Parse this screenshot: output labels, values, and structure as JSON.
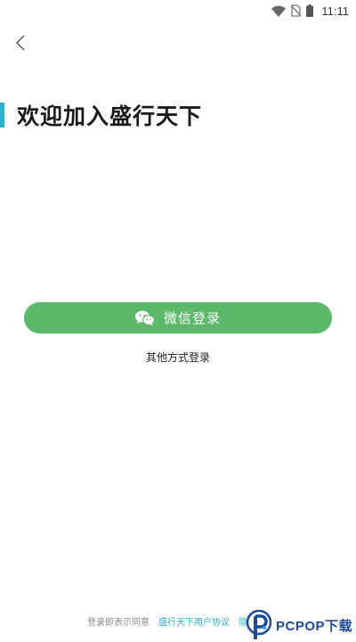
{
  "status_bar": {
    "time": "11:11"
  },
  "header": {
    "title": "欢迎加入盛行天下"
  },
  "login": {
    "wechat_label": "微信登录",
    "other_label": "其他方式登录"
  },
  "agreement": {
    "prefix": "登录即表示同意",
    "user_agreement": "盛行天下用户协议",
    "privacy": "隐私"
  },
  "watermark": {
    "text": "PCPOP下载"
  },
  "colors": {
    "accent": "#2ab0c8",
    "wechat_green": "#5cb96a",
    "watermark_blue": "#1f4a96"
  }
}
